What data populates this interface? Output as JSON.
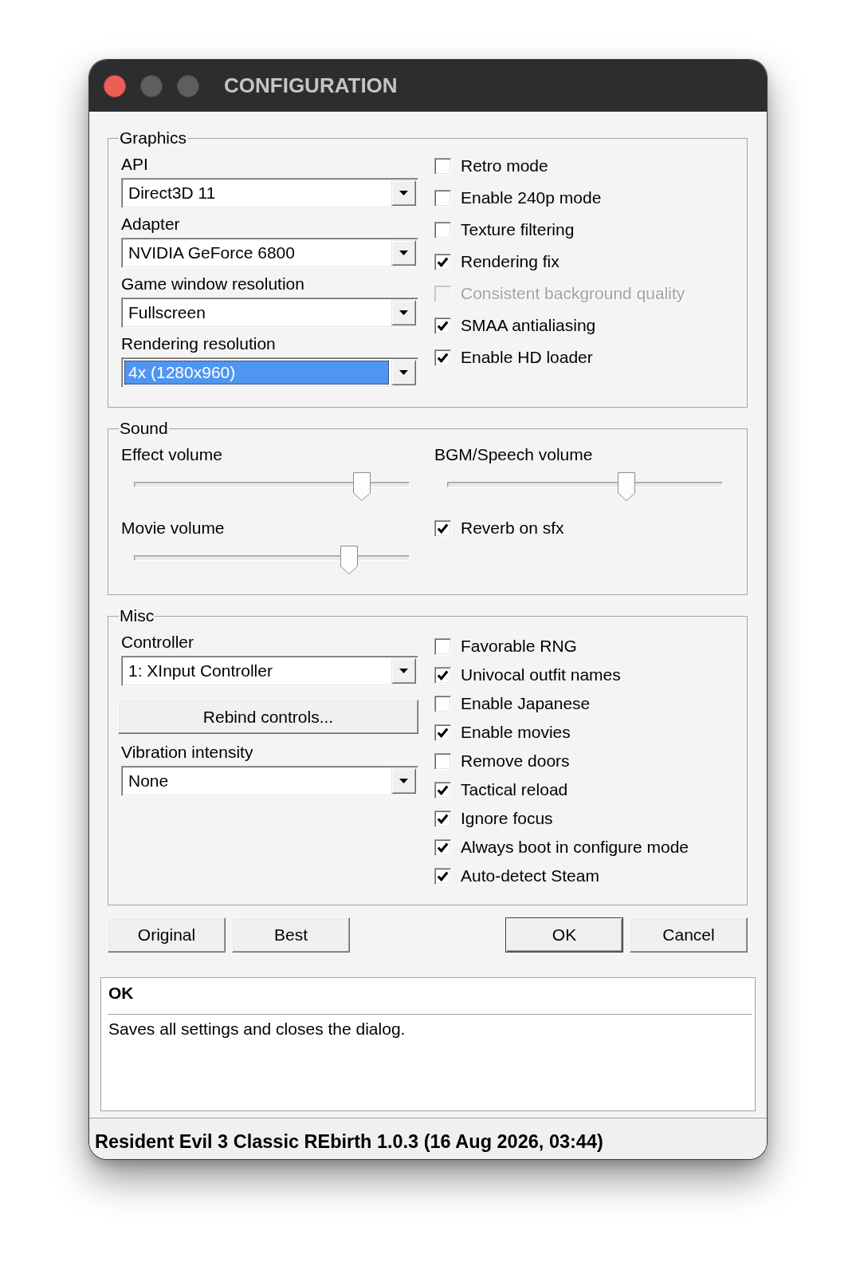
{
  "window": {
    "title": "CONFIGURATION"
  },
  "graphics": {
    "legend": "Graphics",
    "dropdowns": [
      {
        "label": "API",
        "value": "Direct3D 11",
        "focused": false
      },
      {
        "label": "Adapter",
        "value": "NVIDIA GeForce 6800",
        "focused": false
      },
      {
        "label": "Game window resolution",
        "value": "Fullscreen",
        "focused": false
      },
      {
        "label": "Rendering resolution",
        "value": "4x (1280x960)",
        "focused": true
      }
    ],
    "checkboxes": [
      {
        "label": "Retro mode",
        "checked": false,
        "disabled": false
      },
      {
        "label": "Enable 240p mode",
        "checked": false,
        "disabled": false
      },
      {
        "label": "Texture filtering",
        "checked": false,
        "disabled": false
      },
      {
        "label": "Rendering fix",
        "checked": true,
        "disabled": false
      },
      {
        "label": "Consistent background quality",
        "checked": false,
        "disabled": true
      },
      {
        "label": "SMAA antialiasing",
        "checked": true,
        "disabled": false
      },
      {
        "label": "Enable HD loader",
        "checked": true,
        "disabled": false
      }
    ]
  },
  "sound": {
    "legend": "Sound",
    "items": [
      {
        "kind": "slider",
        "label": "Effect volume",
        "level": 0.85
      },
      {
        "kind": "slider",
        "label": "BGM/Speech volume",
        "level": 0.66
      },
      {
        "kind": "slider",
        "label": "Movie volume",
        "level": 0.8
      },
      {
        "kind": "checkbox",
        "label": "Reverb on sfx",
        "checked": true
      }
    ]
  },
  "misc": {
    "legend": "Misc",
    "controls": [
      {
        "kind": "dropdown",
        "label": "Controller",
        "value": "1: XInput Controller"
      },
      {
        "kind": "button",
        "label": "Rebind controls..."
      },
      {
        "kind": "dropdown",
        "label": "Vibration intensity",
        "value": "None"
      }
    ],
    "checkboxes": [
      {
        "label": "Favorable RNG",
        "checked": false
      },
      {
        "label": "Univocal outfit names",
        "checked": true
      },
      {
        "label": "Enable Japanese",
        "checked": false
      },
      {
        "label": "Enable movies",
        "checked": true
      },
      {
        "label": "Remove doors",
        "checked": false
      },
      {
        "label": "Tactical reload",
        "checked": true
      },
      {
        "label": "Ignore focus",
        "checked": true
      },
      {
        "label": "Always boot in configure mode",
        "checked": true
      },
      {
        "label": "Auto-detect Steam",
        "checked": true
      }
    ]
  },
  "preset_buttons": [
    {
      "label": "Original"
    },
    {
      "label": "Best"
    }
  ],
  "dialog_buttons": [
    {
      "label": "OK",
      "default": true
    },
    {
      "label": "Cancel",
      "default": false
    }
  ],
  "info": {
    "title": "OK",
    "text": "Saves all settings and closes the dialog."
  },
  "status_bar": {
    "text": "Resident Evil 3 Classic REbirth 1.0.3 (16 Aug 2026, 03:44)"
  }
}
